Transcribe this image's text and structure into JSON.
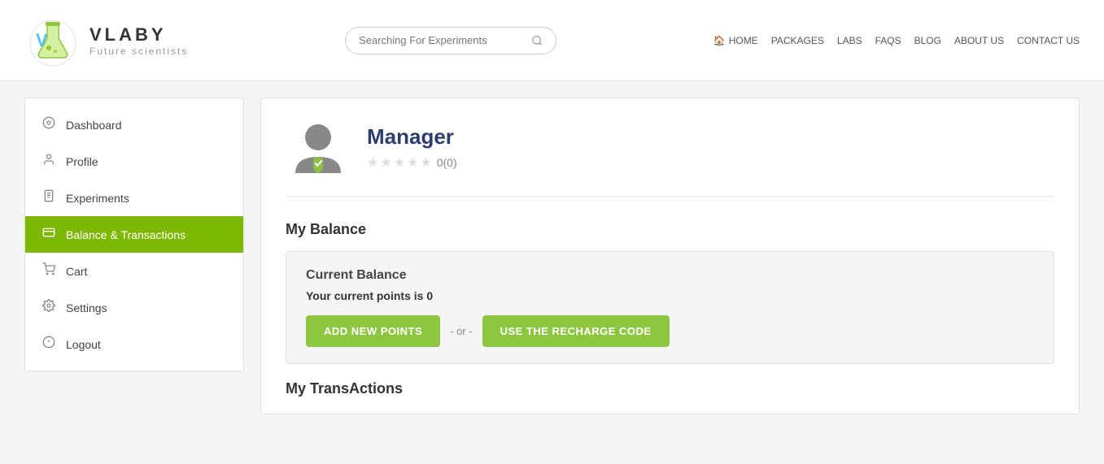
{
  "header": {
    "logo_title": "VLABY",
    "logo_subtitle": "Future scientists",
    "search_placeholder": "Searching For Experiments",
    "nav": [
      {
        "label": "HOME",
        "name": "home",
        "icon": "🏠"
      },
      {
        "label": "PACKAGES",
        "name": "packages"
      },
      {
        "label": "LABS",
        "name": "labs"
      },
      {
        "label": "FAQS",
        "name": "faqs"
      },
      {
        "label": "BLOG",
        "name": "blog"
      },
      {
        "label": "ABOUT US",
        "name": "about-us"
      },
      {
        "label": "CONTACT US",
        "name": "contact-us"
      }
    ]
  },
  "sidebar": {
    "items": [
      {
        "label": "Dashboard",
        "name": "dashboard",
        "icon": "◎",
        "active": false
      },
      {
        "label": "Profile",
        "name": "profile",
        "icon": "👤",
        "active": false
      },
      {
        "label": "Experiments",
        "name": "experiments",
        "icon": "📄",
        "active": false
      },
      {
        "label": "Balance & Transactions",
        "name": "balance-transactions",
        "icon": "💳",
        "active": true
      },
      {
        "label": "Cart",
        "name": "cart",
        "icon": "🛒",
        "active": false
      },
      {
        "label": "Settings",
        "name": "settings",
        "icon": "⚙",
        "active": false
      },
      {
        "label": "Logout",
        "name": "logout",
        "icon": "⏻",
        "active": false
      }
    ]
  },
  "content": {
    "user_name": "Manager",
    "rating_value": "0(0)",
    "stars": [
      false,
      false,
      false,
      false,
      false
    ],
    "my_balance_title": "My Balance",
    "balance_section": {
      "label": "Current Balance",
      "points_text": "Your current points is",
      "points_value": "0",
      "add_new_points_btn": "ADD NEW POINTS",
      "or_text": "- or -",
      "recharge_code_btn": "USE THE RECHARGE CODE"
    },
    "transactions_title": "My TransActions"
  }
}
